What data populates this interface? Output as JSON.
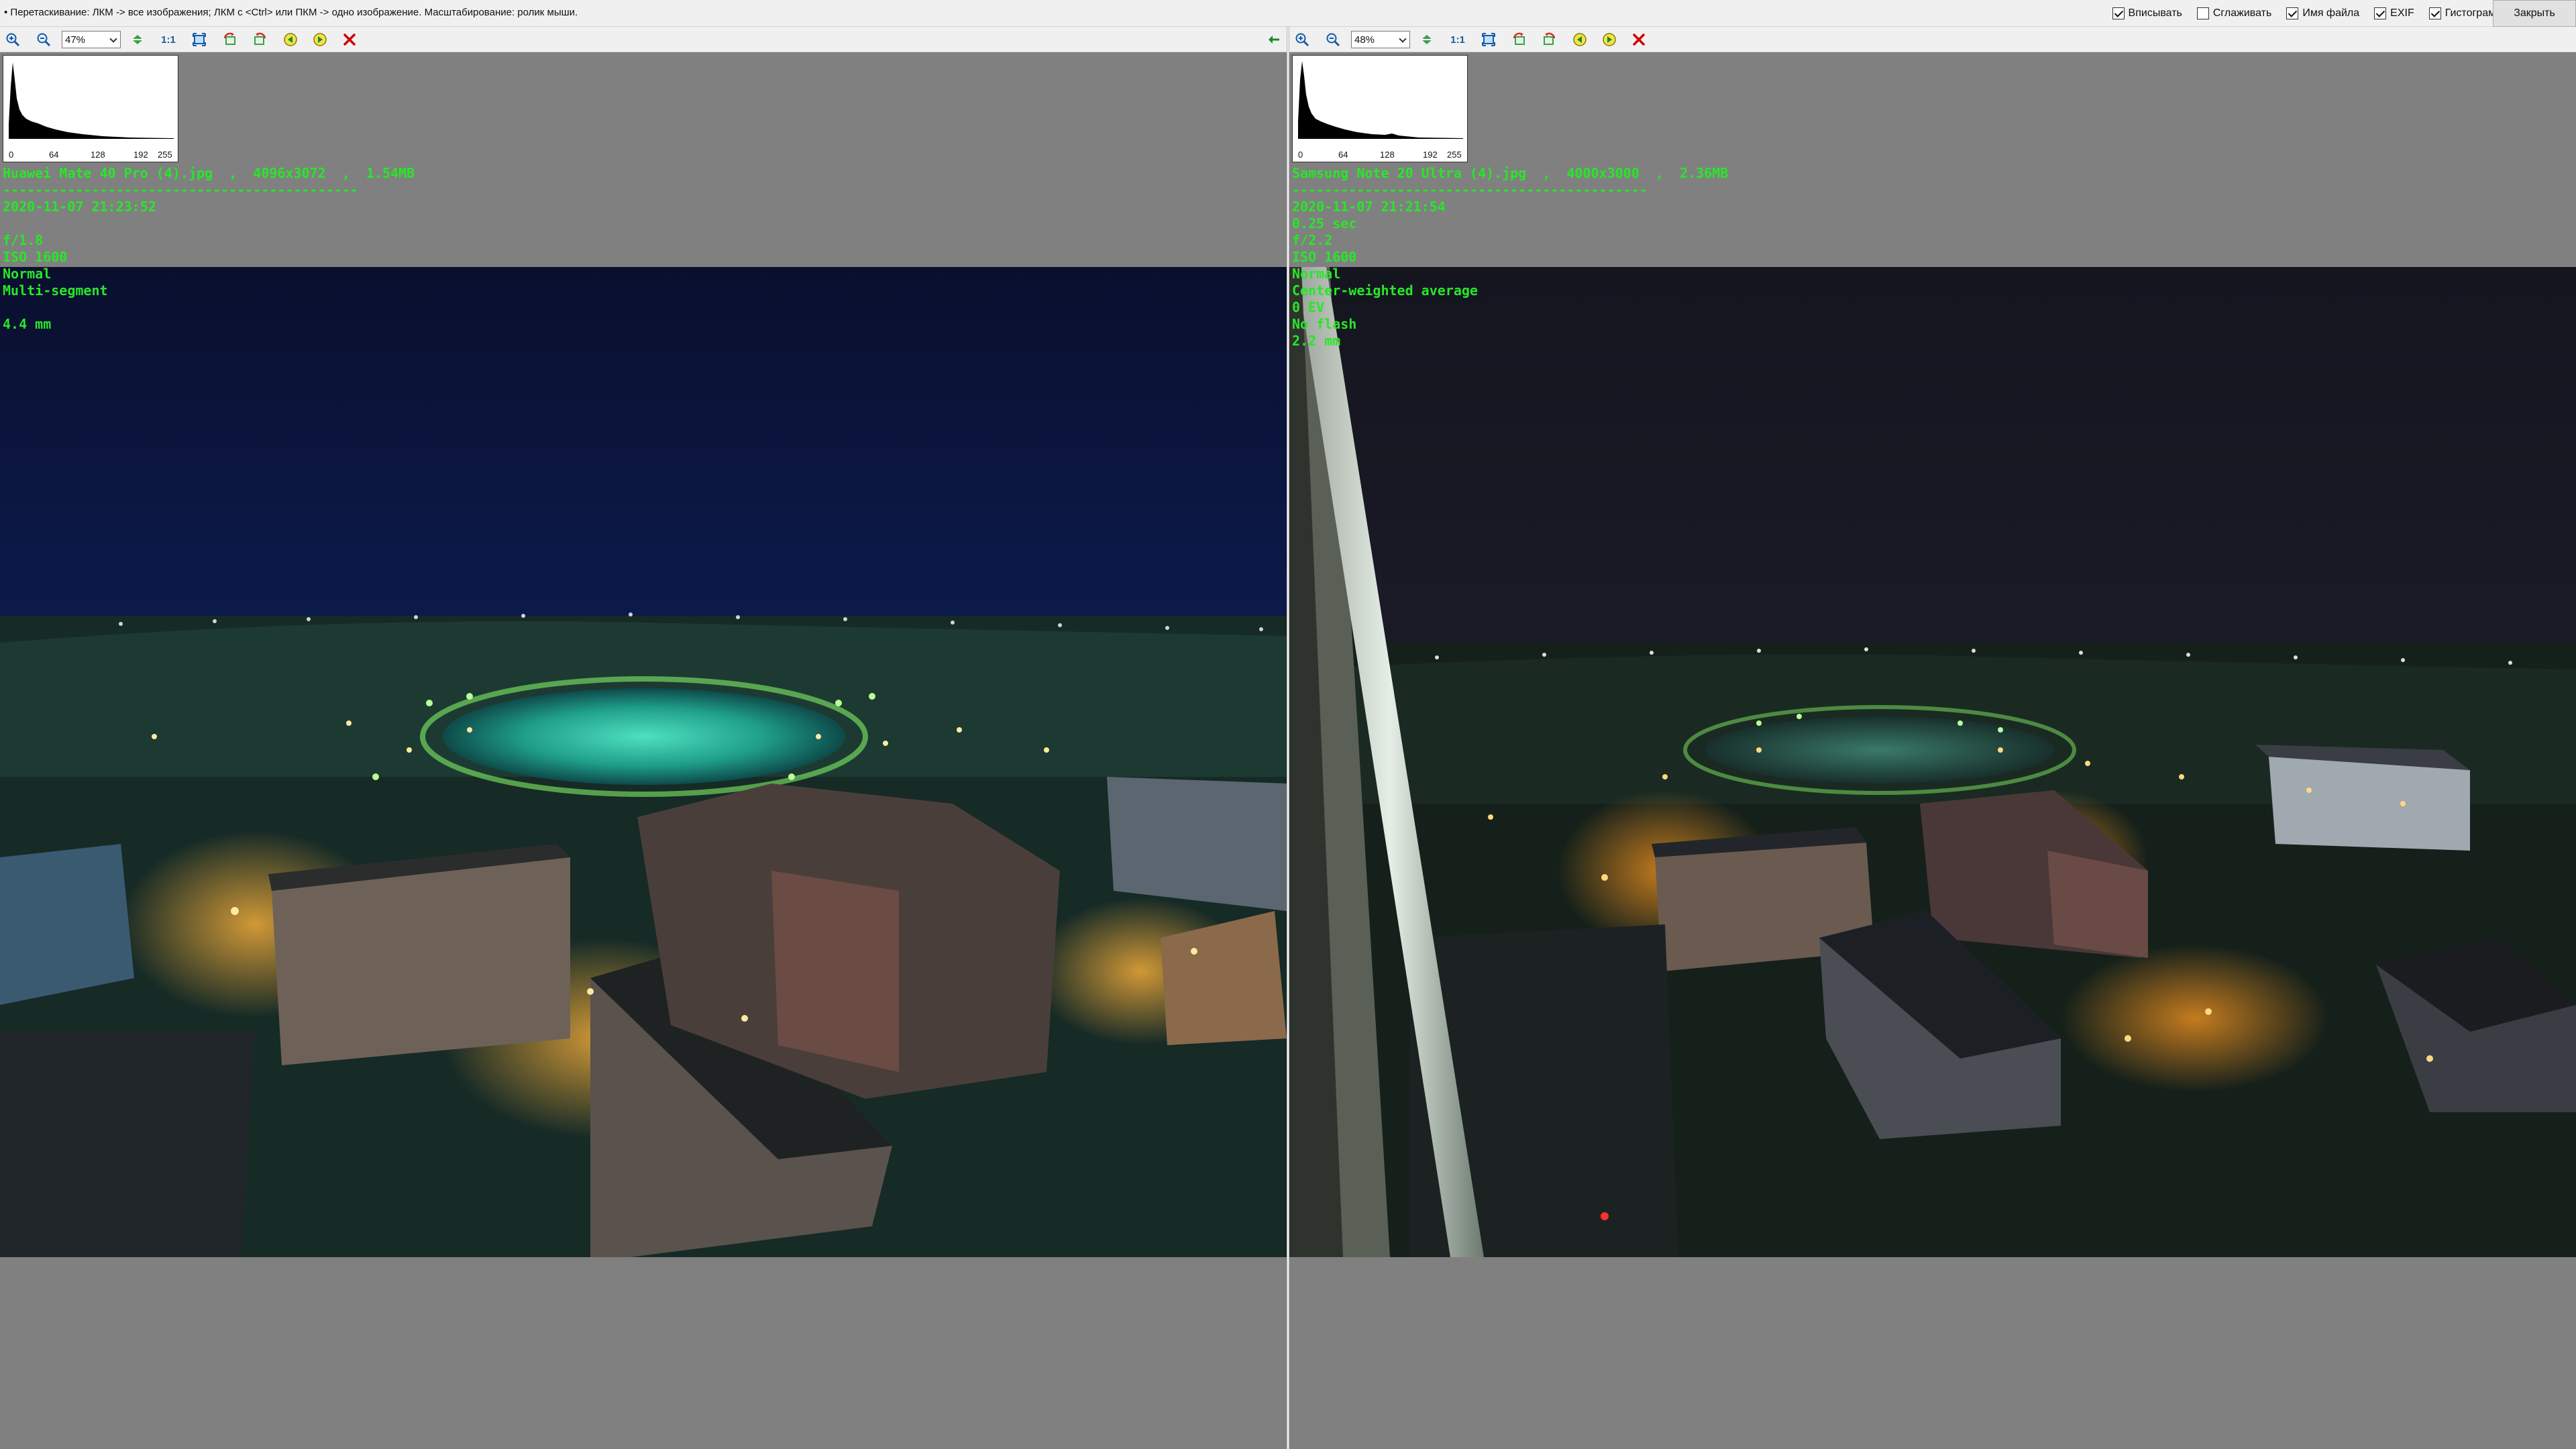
{
  "topbar": {
    "hint": "• Перетаскивание: ЛКМ -> все изображения; ЛКМ с <Ctrl> или ПКМ -> одно изображение. Масштабирование: ролик мыши.",
    "options": [
      {
        "label": "Вписывать",
        "checked": true
      },
      {
        "label": "Сглаживать",
        "checked": false
      },
      {
        "label": "Имя файла",
        "checked": true
      },
      {
        "label": "EXIF",
        "checked": true
      },
      {
        "label": "Гистограмма",
        "checked": true
      }
    ],
    "close_label": "Закрыть"
  },
  "histogram_ticks": [
    "0",
    "64",
    "128",
    "192",
    "255"
  ],
  "left": {
    "zoom": "47%",
    "one_to_one": "1:1",
    "exif": {
      "file_line": "Huawei Mate 40 Pro (4).jpg  ,  4096x3072  ,  1.54MB",
      "separator": "--------------------------------------------",
      "lines": [
        "2020-11-07 21:23:52",
        "",
        "f/1.8",
        "ISO 1600",
        "Normal",
        "Multi-segment",
        "",
        "4.4 mm"
      ]
    }
  },
  "right": {
    "zoom": "48%",
    "one_to_one": "1:1",
    "exif": {
      "file_line": "Samsung Note 20 Ultra (4).jpg  ,  4000x3000  ,  2.36MB",
      "separator": "--------------------------------------------",
      "lines": [
        "2020-11-07 21:21:54",
        "0.25 sec",
        "f/2.2",
        "ISO 1600",
        "Normal",
        "Center-weighted average",
        "0 EV",
        "No flash",
        "2.2 mm"
      ]
    }
  },
  "icons": [
    "zoom-in-icon",
    "zoom-out-icon",
    "fit-icon",
    "one-to-one-icon",
    "fullscreen-icon",
    "rotate-left-icon",
    "rotate-right-icon",
    "prev-icon",
    "next-icon",
    "delete-icon",
    "swap-arrow-icon"
  ],
  "colors": {
    "exif_text": "#29e629",
    "pane_bg": "#808080",
    "close_icon": "#d00000"
  }
}
